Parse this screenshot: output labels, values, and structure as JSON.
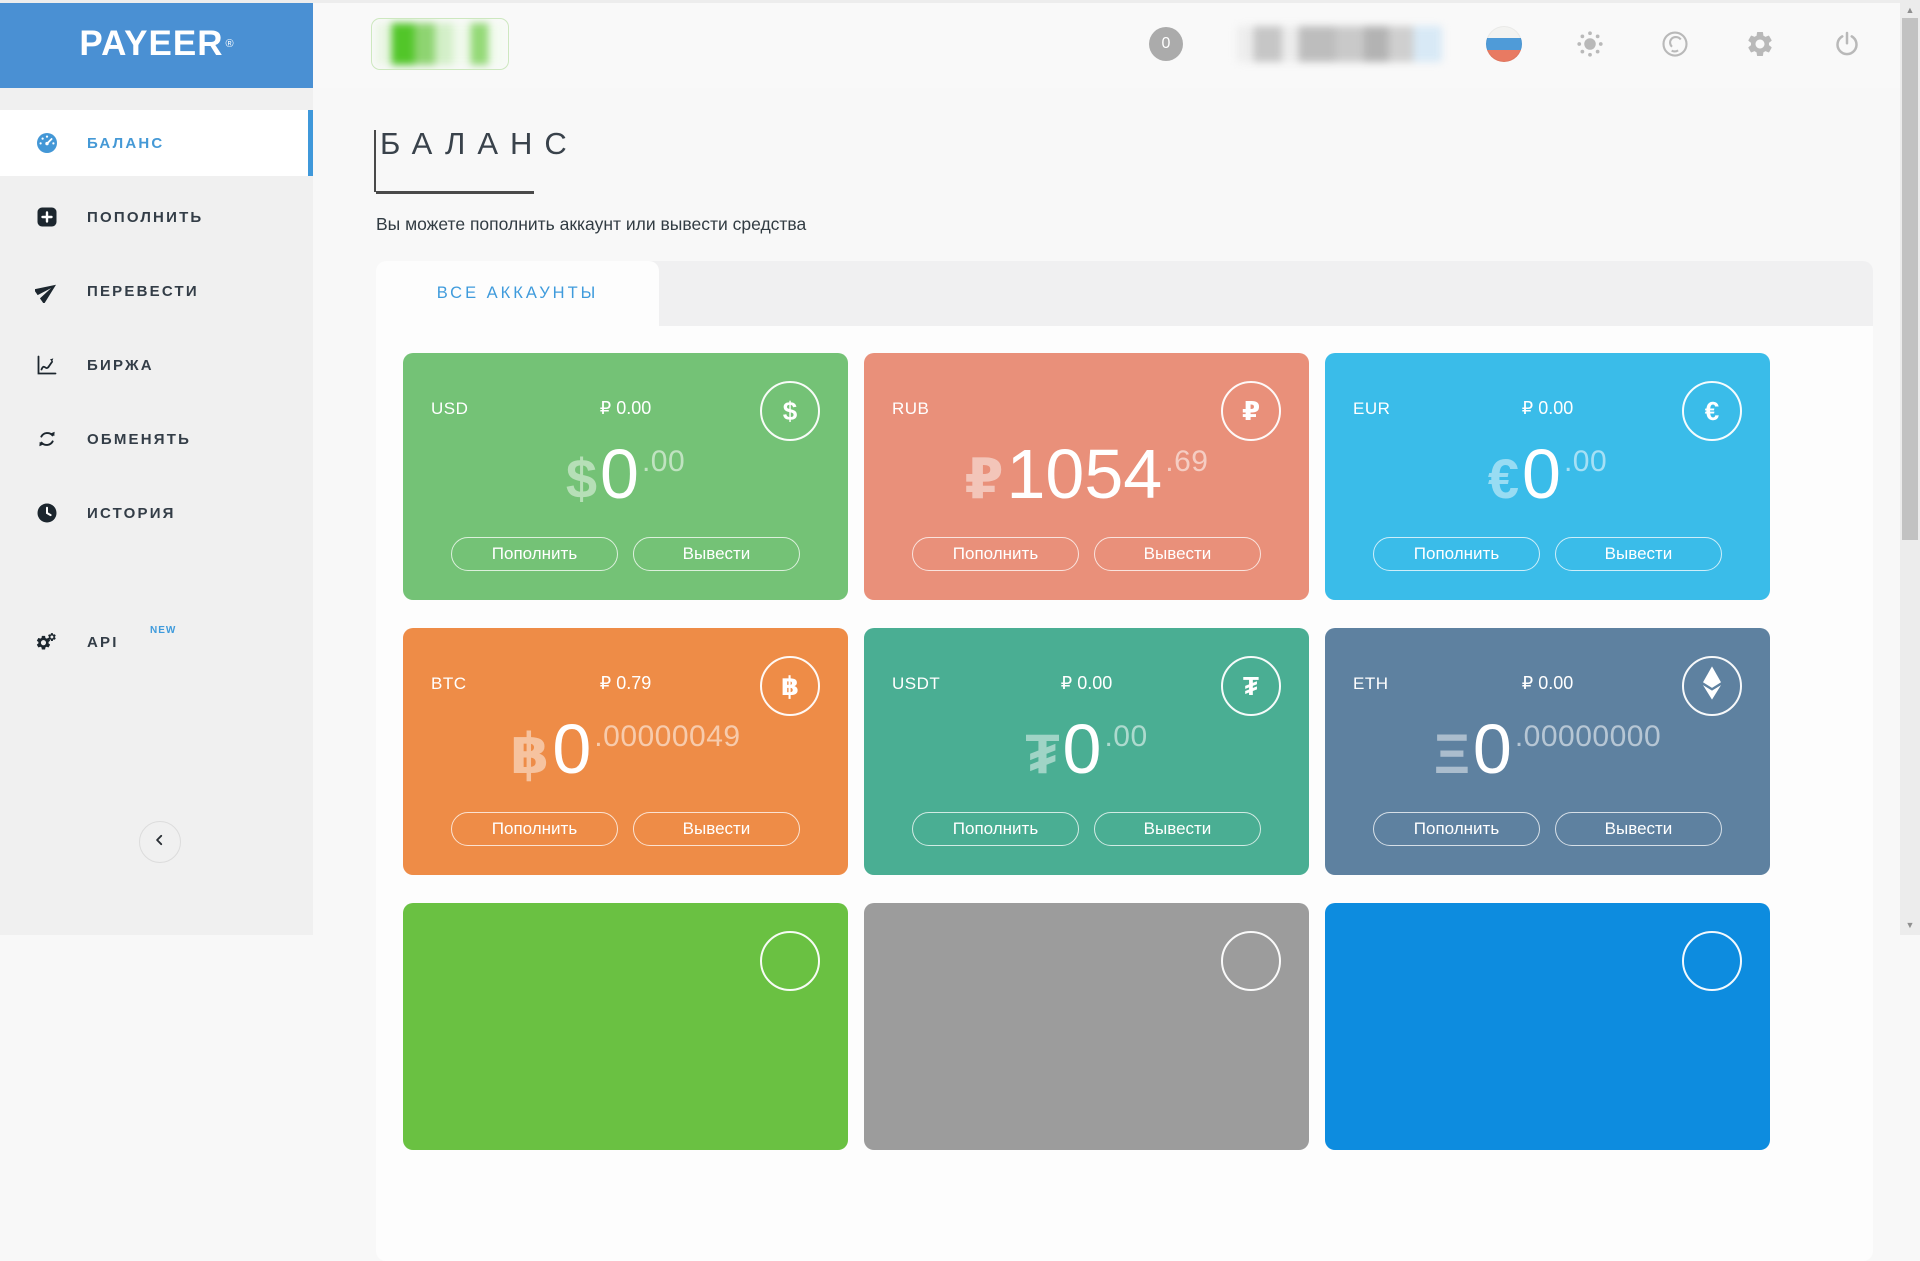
{
  "brand": {
    "name": "PAYEER",
    "registered": "®"
  },
  "sidebar": {
    "items": [
      {
        "id": "balance",
        "label": "БАЛАНС",
        "icon": "gauge-icon",
        "active": true
      },
      {
        "id": "deposit",
        "label": "ПОПОЛНИТЬ",
        "icon": "deposit-plus-icon"
      },
      {
        "id": "transfer",
        "label": "ПЕРЕВЕСТИ",
        "icon": "send-icon"
      },
      {
        "id": "exchange",
        "label": "БИРЖА",
        "icon": "exchange-chart-icon"
      },
      {
        "id": "swap",
        "label": "ОБМЕНЯТЬ",
        "icon": "swap-icon"
      },
      {
        "id": "history",
        "label": "ИСТОРИЯ",
        "icon": "history-clock-icon"
      },
      {
        "id": "api",
        "label": "API",
        "icon": "api-gears-icon",
        "badge": "NEW"
      }
    ],
    "collapse_icon": "chevron-left-icon"
  },
  "topbar": {
    "notification_count": "0",
    "language_flag": "russian-flag",
    "icons": [
      "brightness-icon",
      "support-icon",
      "settings-gear-icon",
      "power-icon"
    ]
  },
  "page": {
    "title": "БАЛАНС",
    "subtitle": "Вы можете пополнить аккаунт или вывести средства"
  },
  "tabs": [
    {
      "label": "ВСЕ АККАУНТЫ",
      "active": true
    }
  ],
  "card_buttons": {
    "deposit": "Пополнить",
    "withdraw": "Вывести"
  },
  "accounts": [
    {
      "code": "USD",
      "converted": "₽ 0.00",
      "symbol": "$",
      "whole": "0",
      "fraction": ".00",
      "color": "#74c276"
    },
    {
      "code": "RUB",
      "converted": "",
      "symbol": "₽",
      "whole": "1054",
      "fraction": ".69",
      "color": "#e9907a"
    },
    {
      "code": "EUR",
      "converted": "₽ 0.00",
      "symbol": "€",
      "whole": "0",
      "fraction": ".00",
      "color": "#3abce9"
    },
    {
      "code": "BTC",
      "converted": "₽ 0.79",
      "symbol": "฿",
      "whole": "0",
      "fraction": ".00000049",
      "color": "#ee8c47"
    },
    {
      "code": "USDT",
      "converted": "₽ 0.00",
      "symbol": "₮",
      "whole": "0",
      "fraction": ".00",
      "color": "#4aae93"
    },
    {
      "code": "ETH",
      "converted": "₽ 0.00",
      "symbol": "Ξ",
      "icon": "ethereum",
      "whole": "0",
      "fraction": ".00000000",
      "color": "#5e81a0"
    }
  ],
  "partial_accounts": [
    {
      "color": "#6ac142"
    },
    {
      "color": "#9c9c9c"
    },
    {
      "color": "#0d8cdf"
    }
  ],
  "colors": {
    "accent_blue": "#3f9bdc",
    "sidebar_header_blue": "#4a90d3",
    "active_item_bar": "#3f98da"
  }
}
